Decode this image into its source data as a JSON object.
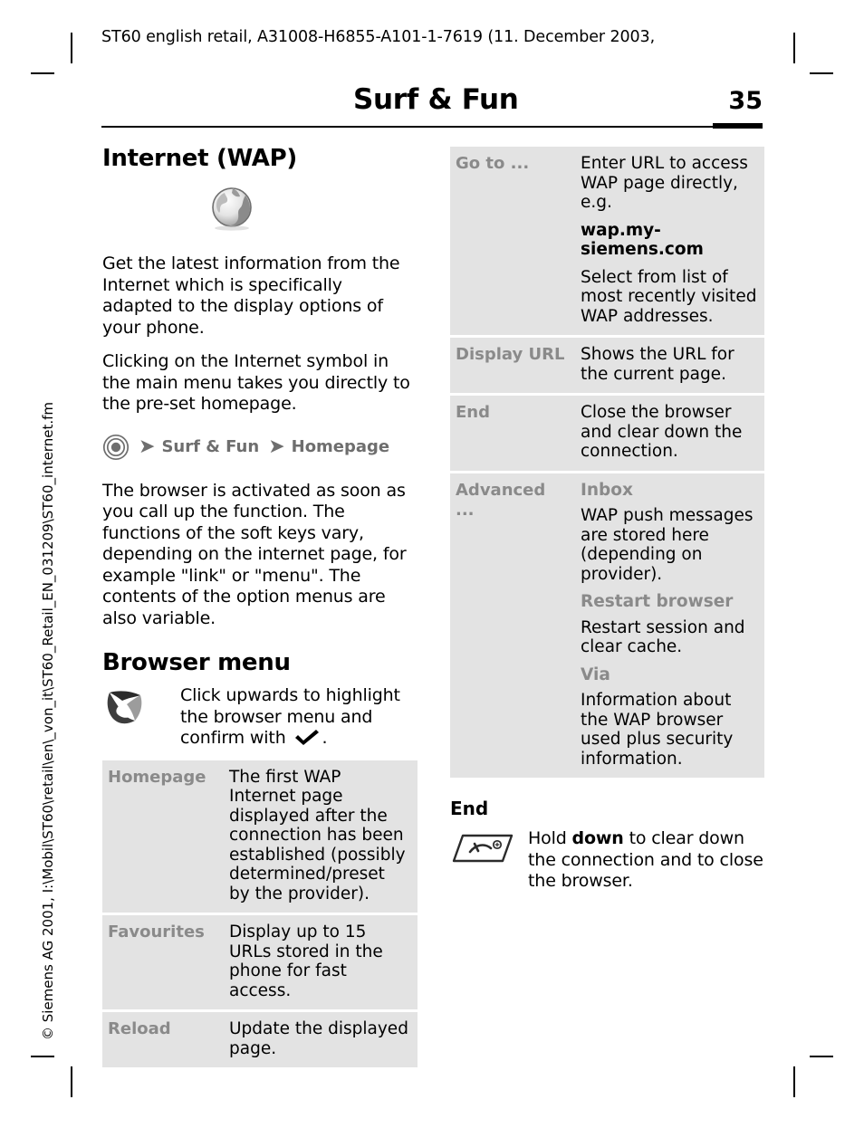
{
  "running_head": "ST60 english retail, A31008-H6855-A101-1-7619 (11. December 2003,",
  "header": {
    "chapter_title": "Surf & Fun",
    "page_number": "35"
  },
  "spine_text": "© Siemens AG 2001, I:\\Mobil\\ST60\\retail\\en\\_von_it\\ST60_Retail_EN_031209\\ST60_internet.fm",
  "left_column": {
    "section_title": "Internet (WAP)",
    "paragraph_1": "Get the latest information from the Internet which is specifically adapted to the display options of your phone.",
    "paragraph_2": "Clicking on the Internet symbol in the main menu takes you directly to the pre-set homepage.",
    "nav_path": {
      "arrow": "➤",
      "step_1": "Surf & Fun",
      "step_2": "Homepage"
    },
    "paragraph_3": "The browser is activated as soon as you call up the function. The functions of the soft keys vary, depending on the internet page, for example \"link\" or \"menu\". The contents of the option menus are also variable.",
    "browser_menu_title": "Browser menu",
    "joystick_instruction_before": "Click upwards to highlight the browser menu and confirm with",
    "joystick_instruction_after": ".",
    "table": [
      {
        "key": "Homepage",
        "value": "The first WAP Internet page displayed after the connection has been established (possibly determined/preset by the provider)."
      },
      {
        "key": "Favourites",
        "value": "Display up to 15 URLs stored in the phone for fast access."
      },
      {
        "key": "Reload",
        "value": "Update the displayed page."
      }
    ]
  },
  "right_column": {
    "table": [
      {
        "key": "Go to ...",
        "lines": [
          {
            "text": "Enter URL to access WAP page directly, e.g.",
            "style": "normal"
          },
          {
            "text": "wap.my-siemens.com",
            "style": "bold"
          },
          {
            "text": "Select from list of most recently visited WAP addresses.",
            "style": "normal"
          }
        ]
      },
      {
        "key": "Display URL",
        "lines": [
          {
            "text": "Shows the URL for the current page.",
            "style": "normal"
          }
        ]
      },
      {
        "key": "End",
        "lines": [
          {
            "text": "Close the browser and clear down the connection.",
            "style": "normal"
          }
        ]
      },
      {
        "key": "Advanced ...",
        "lines": [
          {
            "text": "Inbox",
            "style": "subkey"
          },
          {
            "text": "WAP push messages are stored here (depending on provider).",
            "style": "normal"
          },
          {
            "text": "Restart browser",
            "style": "subkey"
          },
          {
            "text": "Restart session and clear cache.",
            "style": "normal"
          },
          {
            "text": "Via",
            "style": "subkey"
          },
          {
            "text": "Information about the WAP browser used plus security information.",
            "style": "normal"
          }
        ]
      }
    ],
    "end_section": {
      "title": "End",
      "text_before": "Hold",
      "text_bold": "down",
      "text_after": "to clear down the connection and to close the browser."
    }
  },
  "icons": {
    "globe": "globe-icon",
    "menu_key": "center-menu-key-icon",
    "joystick": "joystick-up-icon",
    "checkmark": "checkmark-icon",
    "end_key": "end-call-key-icon"
  }
}
